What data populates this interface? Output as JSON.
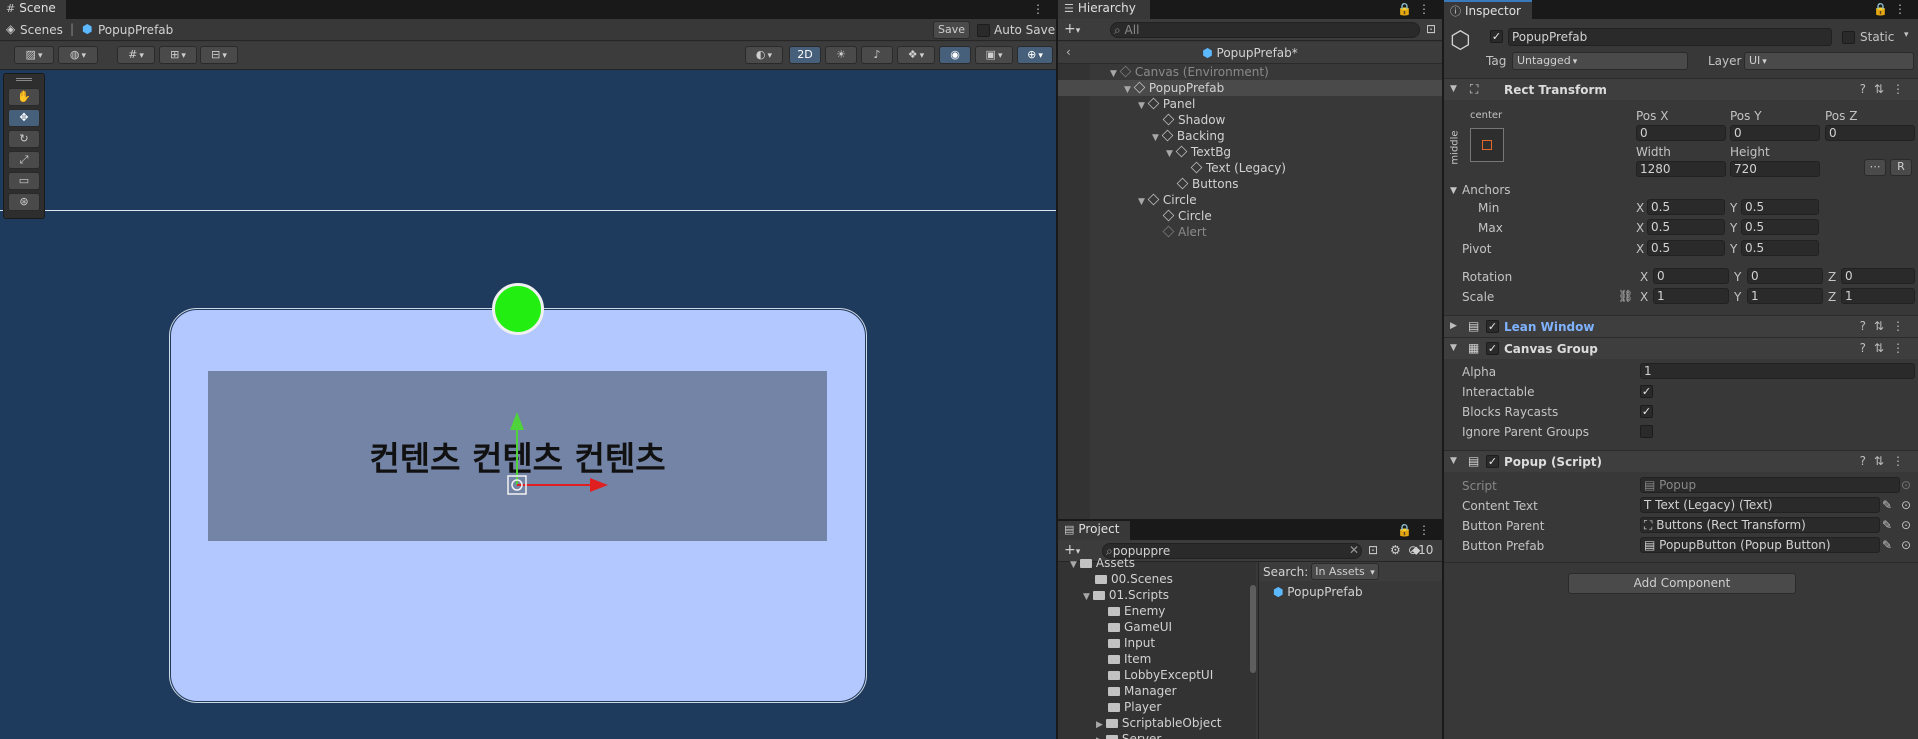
{
  "scene": {
    "tab_label": "Scene",
    "breadcrumb_root": "Scenes",
    "breadcrumb_item": "PopupPrefab",
    "save_label": "Save",
    "auto_save_label": "Auto Save",
    "mode_2d": "2D",
    "popup_text": "컨텐츠 컨텐츠 컨텐츠",
    "colors": {
      "background": "#1e3a5c",
      "popup": "#b3c8ff",
      "text_bg": "#7384a6",
      "circle": "#22ee11"
    }
  },
  "hierarchy": {
    "tab_label": "Hierarchy",
    "search_placeholder": "All",
    "prefab_title": "PopupPrefab*",
    "items": [
      {
        "label": "Canvas (Environment)",
        "depth": 0,
        "expanded": true,
        "dim": true
      },
      {
        "label": "PopupPrefab",
        "depth": 1,
        "expanded": true,
        "selected": true
      },
      {
        "label": "Panel",
        "depth": 2,
        "expanded": true
      },
      {
        "label": "Shadow",
        "depth": 3
      },
      {
        "label": "Backing",
        "depth": 3,
        "expanded": true
      },
      {
        "label": "TextBg",
        "depth": 4,
        "expanded": true
      },
      {
        "label": "Text (Legacy)",
        "depth": 5
      },
      {
        "label": "Buttons",
        "depth": 4
      },
      {
        "label": "Circle",
        "depth": 2,
        "expanded": true
      },
      {
        "label": "Circle",
        "depth": 3
      },
      {
        "label": "Alert",
        "depth": 3,
        "dim": true
      }
    ]
  },
  "project": {
    "tab_label": "Project",
    "search_value": "popuppre",
    "hidden_count": "10",
    "search_label": "Search:",
    "search_scope": "In Assets",
    "tree": [
      {
        "label": "Assets",
        "depth": 0
      },
      {
        "label": "00.Scenes",
        "depth": 1
      },
      {
        "label": "01.Scripts",
        "depth": 1,
        "expanded": true
      },
      {
        "label": "Enemy",
        "depth": 2
      },
      {
        "label": "GameUI",
        "depth": 2
      },
      {
        "label": "Input",
        "depth": 2
      },
      {
        "label": "Item",
        "depth": 2
      },
      {
        "label": "LobbyExceptUI",
        "depth": 2
      },
      {
        "label": "Manager",
        "depth": 2
      },
      {
        "label": "Player",
        "depth": 2
      },
      {
        "label": "ScriptableObject",
        "depth": 2,
        "collapsed": true
      },
      {
        "label": "Server",
        "depth": 2,
        "collapsed": true
      }
    ],
    "result": "PopupPrefab"
  },
  "inspector": {
    "tab_label": "Inspector",
    "object_name": "PopupPrefab",
    "static_label": "Static",
    "tag_label": "Tag",
    "tag_value": "Untagged",
    "layer_label": "Layer",
    "layer_value": "UI",
    "rect_transform": {
      "title": "Rect Transform",
      "anchor_h": "center",
      "anchor_v": "middle",
      "pos_x_label": "Pos X",
      "pos_x": "0",
      "pos_y_label": "Pos Y",
      "pos_y": "0",
      "pos_z_label": "Pos Z",
      "pos_z": "0",
      "width_label": "Width",
      "width": "1280",
      "height_label": "Height",
      "height": "720",
      "r_button": "R",
      "anchors_label": "Anchors",
      "min_label": "Min",
      "min_x": "0.5",
      "min_y": "0.5",
      "max_label": "Max",
      "max_x": "0.5",
      "max_y": "0.5",
      "pivot_label": "Pivot",
      "pivot_x": "0.5",
      "pivot_y": "0.5",
      "rotation_label": "Rotation",
      "rot_x": "0",
      "rot_y": "0",
      "rot_z": "0",
      "scale_label": "Scale",
      "scale_x": "1",
      "scale_y": "1",
      "scale_z": "1"
    },
    "lean_window": {
      "title": "Lean Window"
    },
    "canvas_group": {
      "title": "Canvas Group",
      "alpha_label": "Alpha",
      "alpha": "1",
      "interactable_label": "Interactable",
      "blocks_label": "Blocks Raycasts",
      "ignore_label": "Ignore Parent Groups"
    },
    "popup_script": {
      "title": "Popup (Script)",
      "script_label": "Script",
      "script_value": "Popup",
      "content_label": "Content Text",
      "content_value": "Text (Legacy) (Text)",
      "parent_label": "Button Parent",
      "parent_value": "Buttons (Rect Transform)",
      "prefab_label": "Button Prefab",
      "prefab_value": "PopupButton (Popup Button)"
    },
    "add_component": "Add Component"
  }
}
